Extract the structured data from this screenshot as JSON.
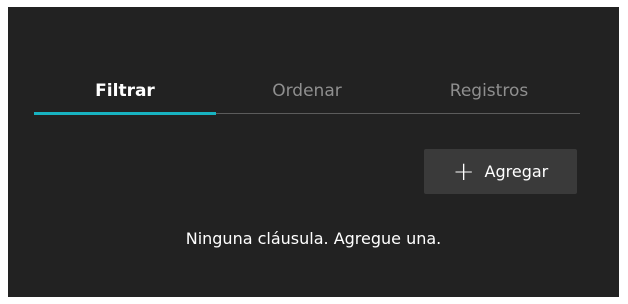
{
  "tabs": [
    {
      "label": "Filtrar",
      "active": true
    },
    {
      "label": "Ordenar",
      "active": false
    },
    {
      "label": "Registros",
      "active": false
    }
  ],
  "add_button": {
    "icon": "plus-icon",
    "label": "Agregar"
  },
  "empty_message": "Ninguna cláusula. Agregue una.",
  "colors": {
    "panel_bg": "#222222",
    "accent": "#18b3c1",
    "inactive_tab": "#8f8f8f",
    "button_bg": "#3a3a3a"
  }
}
